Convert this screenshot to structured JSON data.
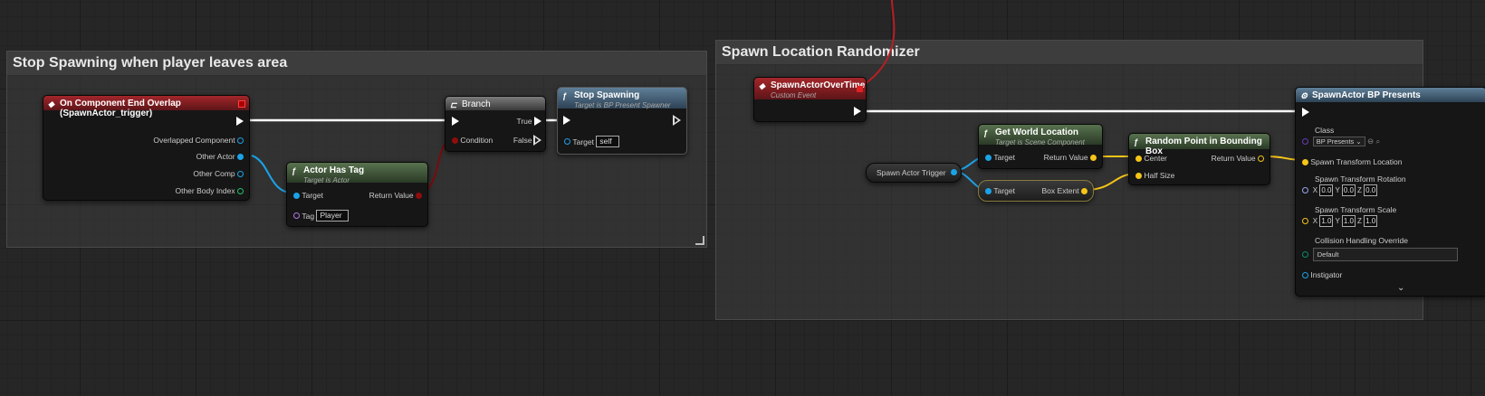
{
  "comments": {
    "left_title": "Stop Spawning when player leaves area",
    "right_title": "Spawn Location Randomizer"
  },
  "colors": {
    "exec": "#ffffff",
    "object": "#1ba3e8",
    "vector": "#f5c518",
    "bool": "#8d0d0d",
    "class": "#6a3ab8"
  },
  "nodes": {
    "overlap": {
      "title": "On Component End Overlap (SpawnActor_trigger)",
      "pins": [
        "Overlapped Component",
        "Other Actor",
        "Other Comp",
        "Other Body Index"
      ]
    },
    "has_tag": {
      "title": "Actor Has Tag",
      "subtitle": "Target is Actor",
      "target": "Target",
      "tag": "Tag",
      "tag_value": "Player",
      "return": "Return Value"
    },
    "branch": {
      "title": "Branch",
      "condition": "Condition",
      "true": "True",
      "false": "False"
    },
    "stop": {
      "title": "Stop Spawning",
      "subtitle": "Target is BP Present Spawner",
      "target": "Target",
      "target_value": "self"
    },
    "spawn_event": {
      "title": "SpawnActorOverTime",
      "subtitle": "Custom Event"
    },
    "trigger_ref": {
      "label": "Spawn Actor Trigger"
    },
    "world_loc": {
      "title": "Get World Location",
      "subtitle": "Target is Scene Component",
      "target": "Target",
      "return": "Return Value"
    },
    "bounds": {
      "target": "Target",
      "extent": "Box Extent"
    },
    "random_point": {
      "title": "Random Point in Bounding Box",
      "center": "Center",
      "half": "Half Size",
      "return": "Return Value"
    },
    "spawn_actor": {
      "title": "SpawnActor BP Presents",
      "class": "Class",
      "class_value": "BP Presents",
      "location": "Spawn Transform Location",
      "rotation": "Spawn Transform Rotation",
      "rot_x": "0.0",
      "rot_y": "0.0",
      "rot_z": "0.0",
      "scale": "Spawn Transform Scale",
      "scale_x": "1.0",
      "scale_y": "1.0",
      "scale_z": "1.0",
      "collision": "Collision Handling Override",
      "collision_value": "Default",
      "instigator": "Instigator",
      "x": "X",
      "y": "Y",
      "z": "Z"
    }
  }
}
